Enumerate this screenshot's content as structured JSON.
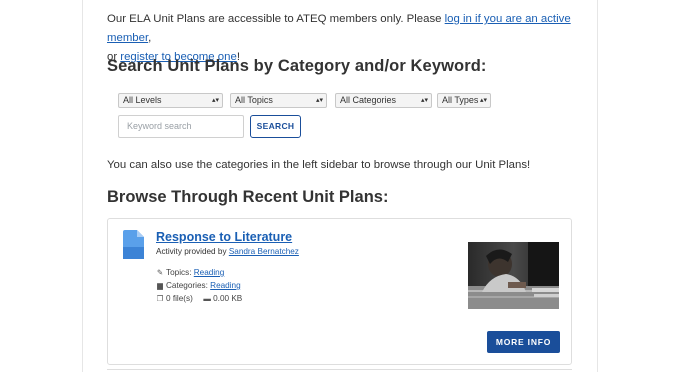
{
  "intro": {
    "text_before": "Our ELA Unit Plans are accessible to ATEQ members only. Please ",
    "login_link": "log in if you are an active member",
    "text_middle_1": ",",
    "text_middle_2": "or ",
    "register_link": "register to become one",
    "text_after": "!"
  },
  "search": {
    "heading": "Search Unit Plans by Category and/or Keyword:",
    "filters": {
      "levels": "All Levels",
      "topics": "All Topics",
      "categories": "All Categories",
      "types": "All Types"
    },
    "keyword_placeholder": "Keyword search",
    "button_label": "SEARCH"
  },
  "sidebar_hint": "You can also use the categories in the left sidebar to browse through our Unit Plans!",
  "browse": {
    "heading": "Browse Through Recent Unit Plans:",
    "items": [
      {
        "title": "Response to Literature",
        "provided_prefix": "Activity provided by ",
        "author": "Sandra Bernatchez",
        "topics_label": "Topics:",
        "topics_value": "Reading",
        "categories_label": "Categories:",
        "categories_value": "Reading",
        "files": "0 file(s)",
        "size": "0.00 KB",
        "more_label": "MORE INFO"
      }
    ]
  },
  "colors": {
    "link": "#1a5fb4",
    "button_primary": "#1a4e9a",
    "doc_icon": "#4a90e2"
  }
}
